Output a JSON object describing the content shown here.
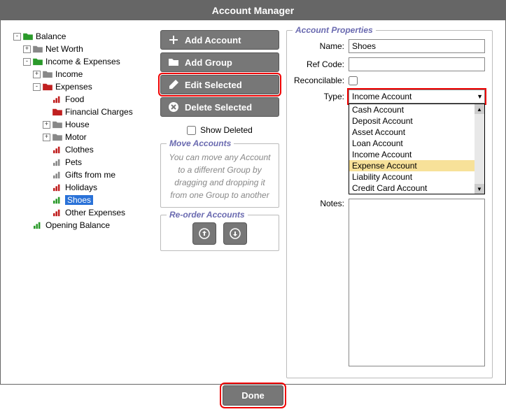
{
  "window": {
    "title": "Account Manager"
  },
  "tree": [
    {
      "depth": 0,
      "expander": "-",
      "icon": "folder",
      "color": "#2a9a2a",
      "label": "Balance"
    },
    {
      "depth": 1,
      "expander": "+",
      "icon": "folder",
      "color": "#888",
      "label": "Net Worth"
    },
    {
      "depth": 1,
      "expander": "-",
      "icon": "folder",
      "color": "#2a9a2a",
      "label": "Income & Expenses"
    },
    {
      "depth": 2,
      "expander": "+",
      "icon": "folder",
      "color": "#888",
      "label": "Income"
    },
    {
      "depth": 2,
      "expander": "-",
      "icon": "folder",
      "color": "#c02020",
      "label": "Expenses"
    },
    {
      "depth": 3,
      "expander": "",
      "icon": "bars",
      "color": "#c02020",
      "label": "Food"
    },
    {
      "depth": 3,
      "expander": "",
      "icon": "folder",
      "color": "#c02020",
      "label": "Financial Charges"
    },
    {
      "depth": 3,
      "expander": "+",
      "icon": "folder",
      "color": "#888",
      "label": "House"
    },
    {
      "depth": 3,
      "expander": "+",
      "icon": "folder",
      "color": "#888",
      "label": "Motor"
    },
    {
      "depth": 3,
      "expander": "",
      "icon": "bars",
      "color": "#c02020",
      "label": "Clothes"
    },
    {
      "depth": 3,
      "expander": "",
      "icon": "bars",
      "color": "#888",
      "label": "Pets"
    },
    {
      "depth": 3,
      "expander": "",
      "icon": "bars",
      "color": "#888",
      "label": "Gifts from me"
    },
    {
      "depth": 3,
      "expander": "",
      "icon": "bars",
      "color": "#c02020",
      "label": "Holidays"
    },
    {
      "depth": 3,
      "expander": "",
      "icon": "bars",
      "color": "#2a9a2a",
      "label": "Shoes",
      "selected": true
    },
    {
      "depth": 3,
      "expander": "",
      "icon": "bars",
      "color": "#c02020",
      "label": "Other Expenses"
    },
    {
      "depth": 1,
      "expander": "",
      "icon": "bars",
      "color": "#2a9a2a",
      "label": "Opening Balance"
    }
  ],
  "actions": {
    "add_account": "Add Account",
    "add_group": "Add Group",
    "edit_selected": "Edit Selected",
    "delete_selected": "Delete Selected",
    "show_deleted": "Show Deleted"
  },
  "move": {
    "legend": "Move Accounts",
    "text": "You can move any Account to a different Group by dragging and dropping it from one Group to another"
  },
  "reorder": {
    "legend": "Re-order Accounts"
  },
  "props": {
    "legend": "Account Properties",
    "name_label": "Name:",
    "name_value": "Shoes",
    "refcode_label": "Ref Code:",
    "refcode_value": "",
    "reconcilable_label": "Reconcilable:",
    "type_label": "Type:",
    "type_value": "Income Account",
    "type_options": [
      "Cash Account",
      "Deposit Account",
      "Asset Account",
      "Loan Account",
      "Income Account",
      "Expense Account",
      "Liability Account",
      "Credit Card Account"
    ],
    "type_hover_index": 5,
    "notes_label": "Notes:",
    "notes_value": ""
  },
  "footer": {
    "done": "Done"
  }
}
